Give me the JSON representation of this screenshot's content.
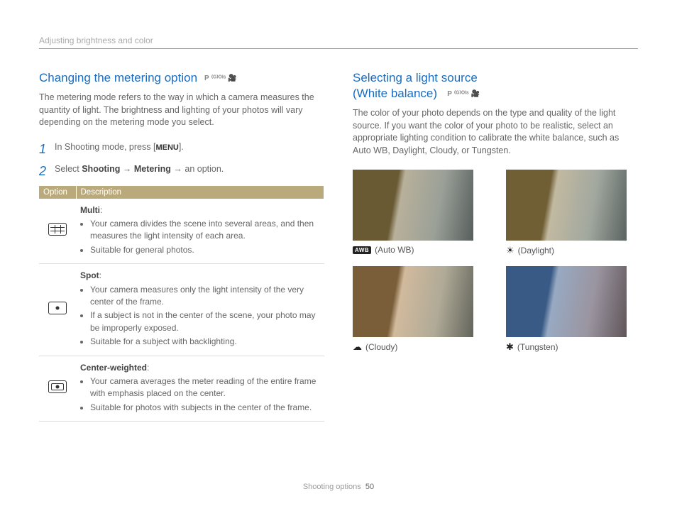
{
  "header": "Adjusting brightness and color",
  "left": {
    "title": "Changing the metering option",
    "modes": [
      "P",
      "⁽ᴳ⁾ᴼᴵˢ",
      "🎥"
    ],
    "intro": "The metering mode refers to the way in which a camera measures the quantity of light. The brightness and lighting of your photos will vary depending on the metering mode you select.",
    "step1_pre": "In Shooting mode, press [",
    "step1_menu": "MENU",
    "step1_post": "].",
    "step2_pre": "Select ",
    "step2_b1": "Shooting",
    "step2_arrow": " → ",
    "step2_b2": "Metering",
    "step2_post": " → an option.",
    "th1": "Option",
    "th2": "Description",
    "opts": [
      {
        "name": "Multi",
        "bullets": [
          "Your camera divides the scene into several areas, and then measures the light intensity of each area.",
          "Suitable for general photos."
        ]
      },
      {
        "name": "Spot",
        "bullets": [
          "Your camera measures only the light intensity of the very center of the frame.",
          "If a subject is not in the center of the scene, your photo may be improperly exposed.",
          "Suitable for a subject with backlighting."
        ]
      },
      {
        "name": "Center-weighted",
        "bullets": [
          "Your camera averages the meter reading of the entire frame with emphasis placed on the center.",
          "Suitable for photos with subjects in the center of the frame."
        ]
      }
    ]
  },
  "right": {
    "title_l1": "Selecting a light source",
    "title_l2": "(White balance)",
    "intro": "The color of your photo depends on the type and quality of the light source. If you want the color of your photo to be realistic, select an appropriate lighting condition to calibrate the white balance, such as Auto WB, Daylight, Cloudy, or Tungsten.",
    "items": [
      {
        "key": "auto",
        "icon": "AWB",
        "label": "(Auto WB)"
      },
      {
        "key": "daylight",
        "icon": "☀",
        "label": "(Daylight)"
      },
      {
        "key": "cloudy",
        "icon": "☁",
        "label": "(Cloudy)"
      },
      {
        "key": "tungsten",
        "icon": "✱",
        "label": "(Tungsten)"
      }
    ]
  },
  "footer": {
    "section": "Shooting options",
    "page": "50"
  }
}
